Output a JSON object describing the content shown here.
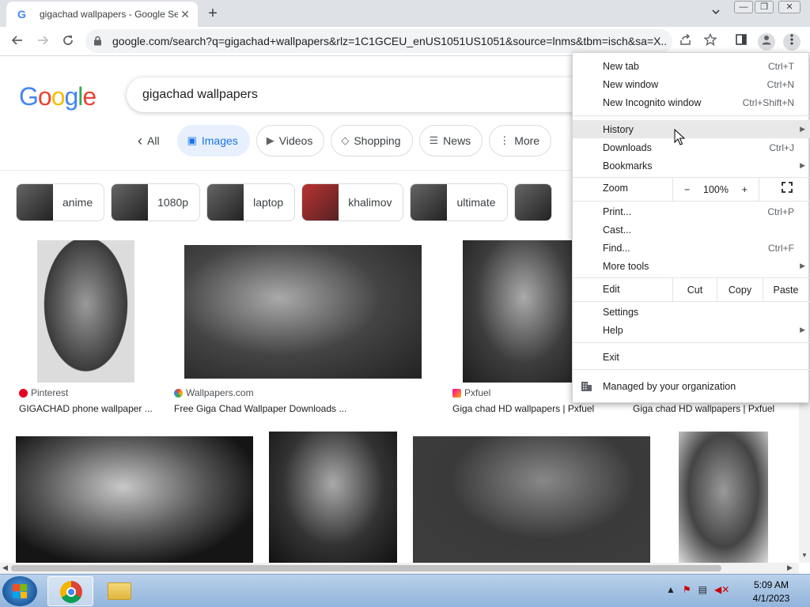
{
  "browser": {
    "tab": {
      "favicon": "G",
      "title": "gigachad wallpapers - Google Se",
      "close": "✕"
    },
    "new_tab": "+",
    "tab_search": "⌄",
    "window_controls": {
      "minimize": "—",
      "restore": "❐",
      "close": "✕"
    },
    "url": "google.com/search?q=gigachad+wallpapers&rlz=1C1GCEU_enUS1051US1051&source=lnms&tbm=isch&sa=X...",
    "icons": {
      "back": "back-arrow-icon",
      "forward": "forward-arrow-icon",
      "reload": "reload-icon",
      "lock": "lock-icon",
      "share": "share-icon",
      "star": "bookmark-star-icon",
      "sidepanel": "side-panel-icon",
      "profile": "profile-icon",
      "menu": "kebab-menu-icon"
    }
  },
  "google": {
    "logo": [
      "G",
      "o",
      "o",
      "g",
      "l",
      "e"
    ],
    "query": "gigachad wallpapers",
    "filters": [
      {
        "label": "All",
        "icon": "‹"
      },
      {
        "label": "Images",
        "icon": "▣"
      },
      {
        "label": "Videos",
        "icon": "▶"
      },
      {
        "label": "Shopping",
        "icon": "◇"
      },
      {
        "label": "News",
        "icon": "☰"
      },
      {
        "label": "More",
        "icon": "⋮"
      }
    ],
    "related": [
      "anime",
      "1080p",
      "laptop",
      "khalimov",
      "ultimate"
    ],
    "results": [
      {
        "source": "Pinterest",
        "title": "GIGACHAD phone wallpaper ..."
      },
      {
        "source": "Wallpapers.com",
        "title": "Free Giga Chad Wallpaper Downloads ..."
      },
      {
        "source": "Pxfuel",
        "title": "Giga chad HD wallpapers | Pxfuel"
      },
      {
        "source": "",
        "title": "Giga chad HD wallpapers | Pxfuel"
      }
    ]
  },
  "menu": {
    "new_tab": {
      "label": "New tab",
      "shortcut": "Ctrl+T"
    },
    "new_window": {
      "label": "New window",
      "shortcut": "Ctrl+N"
    },
    "incognito": {
      "label": "New Incognito window",
      "shortcut": "Ctrl+Shift+N"
    },
    "history": {
      "label": "History"
    },
    "downloads": {
      "label": "Downloads",
      "shortcut": "Ctrl+J"
    },
    "bookmarks": {
      "label": "Bookmarks"
    },
    "zoom": {
      "label": "Zoom",
      "minus": "−",
      "level": "100%",
      "plus": "+"
    },
    "print": {
      "label": "Print...",
      "shortcut": "Ctrl+P"
    },
    "cast": {
      "label": "Cast..."
    },
    "find": {
      "label": "Find...",
      "shortcut": "Ctrl+F"
    },
    "more_tools": {
      "label": "More tools"
    },
    "edit": {
      "label": "Edit",
      "cut": "Cut",
      "copy": "Copy",
      "paste": "Paste"
    },
    "settings": {
      "label": "Settings"
    },
    "help": {
      "label": "Help"
    },
    "exit": {
      "label": "Exit"
    },
    "managed": {
      "label": "Managed by your organization"
    }
  },
  "taskbar": {
    "time": "5:09 AM",
    "date": "4/1/2023",
    "tray_icons": [
      "show-hidden-icons-icon",
      "action-center-flag-icon",
      "network-icon",
      "volume-muted-icon"
    ]
  },
  "colors": {
    "google_blue": "#1a73e8",
    "chip_active_bg": "#e8f0fe",
    "menu_highlight": "#e8e8e8",
    "taskbar": "#b9d1ea"
  }
}
